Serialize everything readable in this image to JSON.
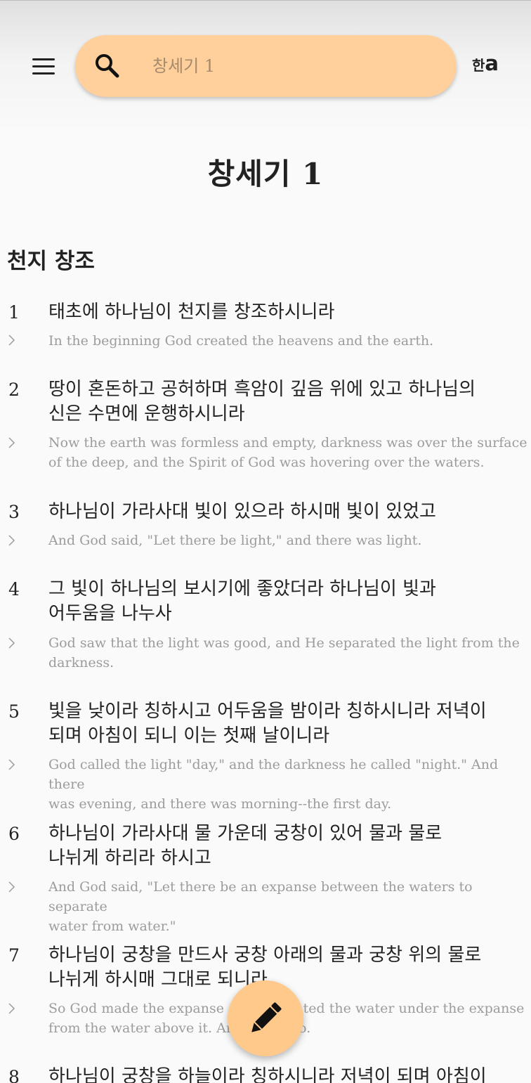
{
  "search": {
    "placeholder": "창세기 1"
  },
  "language_toggle": {
    "ko": "한",
    "latin": "a"
  },
  "chapter_title": "창세기 1",
  "section_heading": "천지 창조",
  "verses": [
    {
      "number": "1",
      "ko": "태초에 하나님이 천지를 창조하시니라",
      "en": "In the beginning God created the heavens and the earth."
    },
    {
      "number": "2",
      "ko": "땅이 혼돈하고 공허하며 흑암이 깊음 위에 있고 하나님의\n신은 수면에 운행하시니라",
      "en": "Now the earth was formless and empty, darkness was over the surface\nof the deep, and the Spirit of God was hovering over the waters."
    },
    {
      "number": "3",
      "ko": "하나님이 가라사대 빛이 있으라 하시매 빛이 있었고",
      "en": "And God said, \"Let there be light,\" and there was light."
    },
    {
      "number": "4",
      "ko": "그 빛이 하나님의 보시기에 좋았더라 하나님이 빛과\n어두움을 나누사",
      "en": "God saw that the light was good, and He separated the light from the\ndarkness."
    },
    {
      "number": "5",
      "ko": "빛을 낮이라 칭하시고 어두움을 밤이라 칭하시니라 저녁이\n되며 아침이 되니 이는 첫째 날이니라",
      "en": "God called the light \"day,\" and the darkness he called \"night.\" And there\nwas evening, and there was morning--the first day."
    },
    {
      "number": "6",
      "ko": "하나님이 가라사대 물 가운데 궁창이 있어 물과 물로\n나뉘게 하리라 하시고",
      "en": "And God said, \"Let there be an expanse between the waters to separate\nwater from water.\""
    },
    {
      "number": "7",
      "ko": "하나님이 궁창을 만드사 궁창 아래의 물과 궁창 위의 물로\n나뉘게 하시매 그대로 되니라",
      "en": "So God made the expanse and separated the water under the expanse\nfrom the water above it. And it was so."
    },
    {
      "number": "8",
      "ko": "하나님이 궁창을 하늘이라 칭하시니라 저녁이 되며 아침이",
      "en": ""
    }
  ],
  "icons": {
    "menu": "hamburger-menu-icon",
    "search": "search-icon",
    "verse_toggle": "chevron-right-icon",
    "fab": "pencil-icon"
  },
  "colors": {
    "accent": "#ffd09b",
    "fab": "#ffc98c",
    "english_text": "#9c9c9c",
    "korean_text": "#222222",
    "placeholder": "#a68a6e"
  }
}
